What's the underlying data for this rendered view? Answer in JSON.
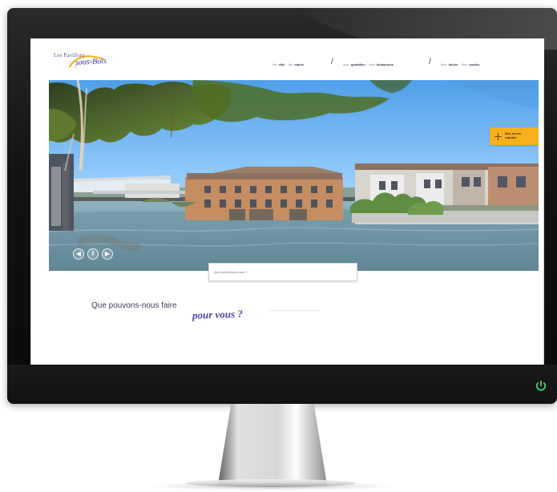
{
  "brand": {
    "line1": "Les Pavillons",
    "line2": "sous-Bois"
  },
  "header": {
    "nav": [
      {
        "prefix": "Ma",
        "strong1": "ville",
        "middle": "· Ma",
        "strong2": "mairie"
      },
      {
        "prefix": "Mon",
        "strong1": "quotidien",
        "middle": "· Mes",
        "strong2": "démarches"
      },
      {
        "prefix": "Mes",
        "strong1": "loisirs",
        "middle": "· Mes",
        "strong2": "sorties"
      }
    ],
    "separator": "/"
  },
  "hero": {
    "quick_access": {
      "line1": "Mes accès",
      "line2": "rapides"
    },
    "controls": [
      {
        "symbol": "◀",
        "icon": "chevron-left-icon"
      },
      {
        "symbol": "Ⅱ",
        "icon": "pause-icon"
      },
      {
        "symbol": "▶",
        "icon": "chevron-right-icon"
      }
    ],
    "search": {
      "placeholder": "Que recherchez-vous ?"
    }
  },
  "main": {
    "section_title": "Que pouvons-nous faire",
    "section_title_accent": "pour vous ?"
  },
  "colors": {
    "monitor_frame": "#111111",
    "power_led": "#3cd26e",
    "quick_access": "#f6b11d",
    "accent_purple": "#4d43ab",
    "nav_text": "#8f8f97"
  },
  "icons": {
    "power": "power-icon"
  }
}
